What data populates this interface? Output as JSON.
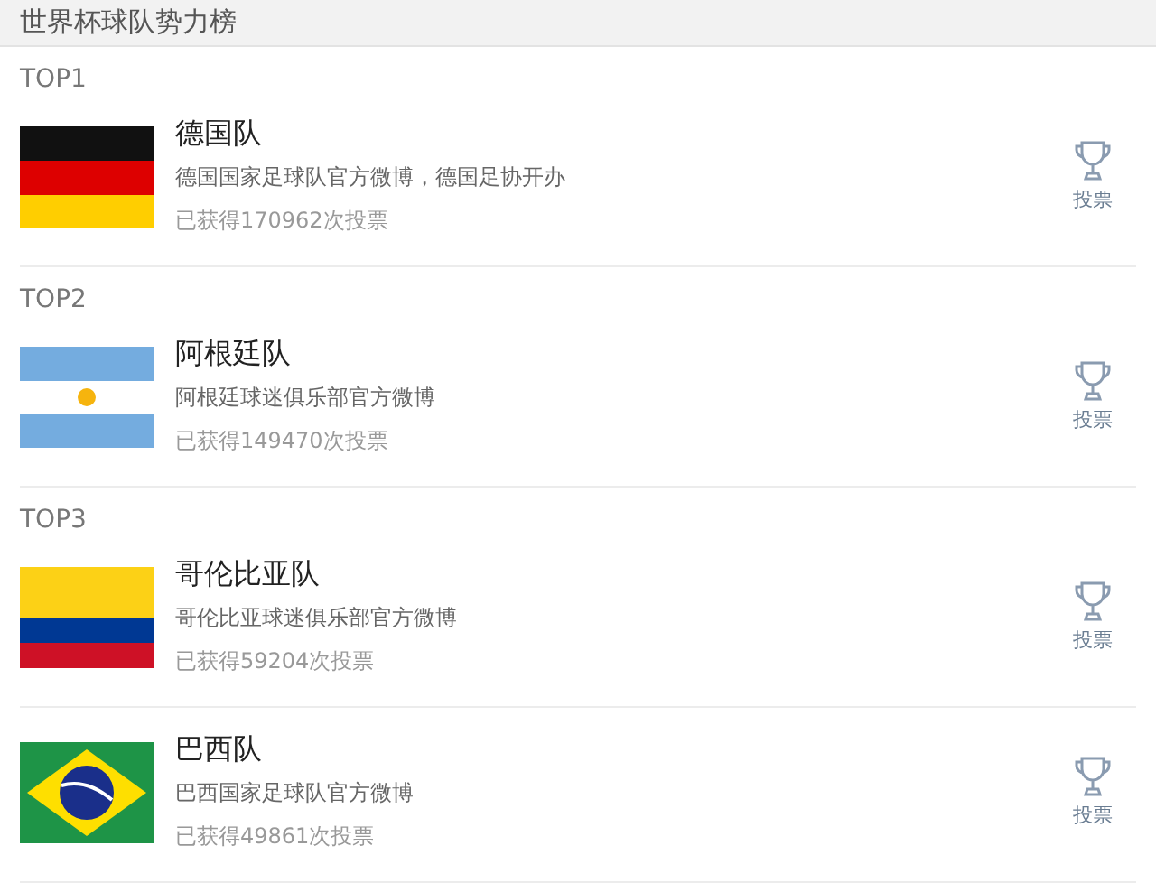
{
  "header": {
    "title": "世界杯球队势力榜"
  },
  "teams": [
    {
      "rank": "TOP1",
      "kind": "germany",
      "name": "德国队",
      "description": "德国国家足球队官方微博，德国足协开办",
      "votes": "已获得170962次投票",
      "vote_button": "投票"
    },
    {
      "rank": "TOP2",
      "kind": "argentina",
      "name": "阿根廷队",
      "description": "阿根廷球迷俱乐部官方微博",
      "votes": "已获得149470次投票",
      "vote_button": "投票"
    },
    {
      "rank": "TOP3",
      "kind": "colombia",
      "name": "哥伦比亚队",
      "description": "哥伦比亚球迷俱乐部官方微博",
      "votes": "已获得59204次投票",
      "vote_button": "投票"
    },
    {
      "kind": "brazil",
      "name": "巴西队",
      "description": "巴西国家足球队官方微博",
      "votes": "已获得49861次投票",
      "vote_button": "投票"
    }
  ]
}
